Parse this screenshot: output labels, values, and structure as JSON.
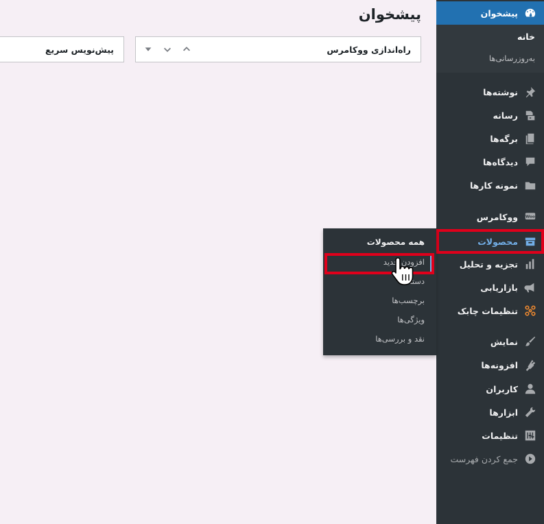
{
  "header": {
    "title": "پیشخوان"
  },
  "widgets": {
    "woocommerce_setup": {
      "title": "راه‌اندازی ووکامرس"
    },
    "quick_draft": {
      "title": "پیش‌نویس سریع"
    }
  },
  "sidebar": {
    "dashboard": {
      "label": "پیشخوان",
      "icon": "dashboard-icon"
    },
    "dashboard_sub": {
      "home": "خانه",
      "updates": "به‌روزرسانی‌ها"
    },
    "items": [
      {
        "label": "نوشته‌ها",
        "icon": "pin-icon"
      },
      {
        "label": "رسانه",
        "icon": "media-icon"
      },
      {
        "label": "برگه‌ها",
        "icon": "pages-icon"
      },
      {
        "label": "دیدگاه‌ها",
        "icon": "comments-icon"
      },
      {
        "label": "نمونه کارها",
        "icon": "folder-icon"
      },
      {
        "label": "ووکامرس",
        "icon": "woo-icon"
      },
      {
        "label": "محصولات",
        "icon": "archive-icon"
      },
      {
        "label": "تجزیه و تحلیل",
        "icon": "chart-icon"
      },
      {
        "label": "بازاریابی",
        "icon": "megaphone-icon"
      },
      {
        "label": "تنظیمات چابک",
        "icon": "chaabk-icon"
      },
      {
        "label": "نمایش",
        "icon": "brush-icon"
      },
      {
        "label": "افزونه‌ها",
        "icon": "plugin-icon"
      },
      {
        "label": "کاربران",
        "icon": "user-icon"
      },
      {
        "label": "ابزارها",
        "icon": "wrench-icon"
      },
      {
        "label": "تنظیمات",
        "icon": "sliders-icon"
      },
      {
        "label": "جمع کردن فهرست",
        "icon": "collapse-icon"
      }
    ],
    "woo_badge": "Woo"
  },
  "flyout": {
    "items": [
      "همه محصولات",
      "افزودن جدید",
      "دسته‌ها",
      "برچسب‌ها",
      "ویژگی‌ها",
      "نقد و بررسی‌ها"
    ]
  },
  "colors": {
    "sidebar_bg": "#2c3338",
    "accent": "#2271b1",
    "highlight": "#e0001b",
    "page_bg": "#f6eff5"
  }
}
